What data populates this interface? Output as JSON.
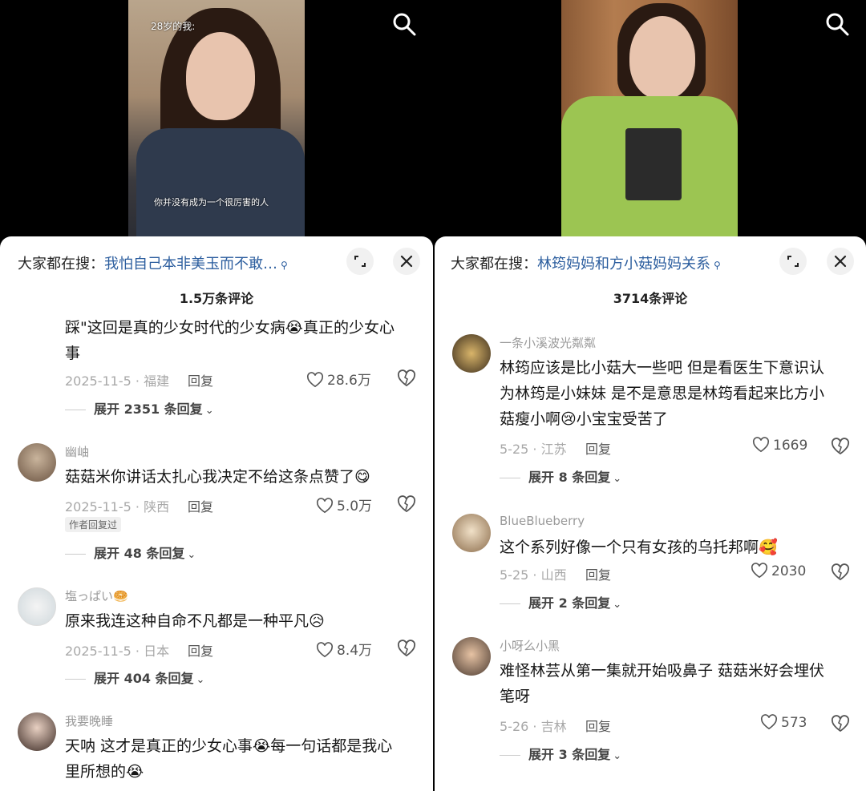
{
  "left": {
    "video_overlay_top": "28岁的我:",
    "video_subtitle": "你并没有成为一个很厉害的人",
    "search_hint_prefix": "大家都在搜：",
    "search_hint_query": "我怕自己本非美玉而不敢…",
    "comment_count": "1.5万条评论",
    "comments": [
      {
        "author": "",
        "text": "踩\"这回是真的少女时代的少女病😭真正的少女心事",
        "date_loc": "2025-11-5 · 福建",
        "reply": "回复",
        "likes": "28.6万",
        "expand": "展开 2351 条回复"
      },
      {
        "author": "幽岫",
        "text": "菇菇米你讲话太扎心我决定不给这条点赞了😋",
        "date_loc": "2025-11-5 · 陕西",
        "reply": "回复",
        "likes": "5.0万",
        "badge": "作者回复过",
        "expand": "展开 48 条回复"
      },
      {
        "author": "塩っぱい🥯",
        "text": "原来我连这种自命不凡都是一种平凡😥",
        "date_loc": "2025-11-5 · 日本",
        "reply": "回复",
        "likes": "8.4万",
        "expand": "展开 404 条回复"
      },
      {
        "author": "我要晚睡",
        "text": "天呐 这才是真正的少女心事😭每一句话都是我心里所想的😭"
      }
    ]
  },
  "right": {
    "search_hint_prefix": "大家都在搜：",
    "search_hint_query": "林筠妈妈和方小菇妈妈关系",
    "comment_count": "3714条评论",
    "comments": [
      {
        "author": "一条小溪波光粼粼",
        "text": "林筠应该是比小菇大一些吧 但是看医生下意识认为林筠是小妹妹 是不是意思是林筠看起来比方小菇瘦小啊😢小宝宝受苦了",
        "date_loc": "5-25 · 江苏",
        "reply": "回复",
        "likes": "1669",
        "expand": "展开 8 条回复"
      },
      {
        "author": "BlueBlueberry",
        "text": "这个系列好像一个只有女孩的乌托邦啊🥰",
        "date_loc": "5-25 · 山西",
        "reply": "回复",
        "likes": "2030",
        "expand": "展开 2 条回复"
      },
      {
        "author": "小呀么小黑",
        "text": "难怪林芸从第一集就开始吸鼻子 菇菇米好会埋伏笔呀",
        "date_loc": "5-26 · 吉林",
        "reply": "回复",
        "likes": "573",
        "expand": "展开 3 条回复"
      }
    ]
  },
  "colors": {
    "link": "#2b5d9e",
    "meta": "#a8a8a8",
    "sheet_bg": "#ffffff"
  },
  "icons": [
    "search-icon",
    "expand-icon",
    "close-icon",
    "heart-icon",
    "dislike-heart-icon",
    "chevron-down-icon"
  ]
}
